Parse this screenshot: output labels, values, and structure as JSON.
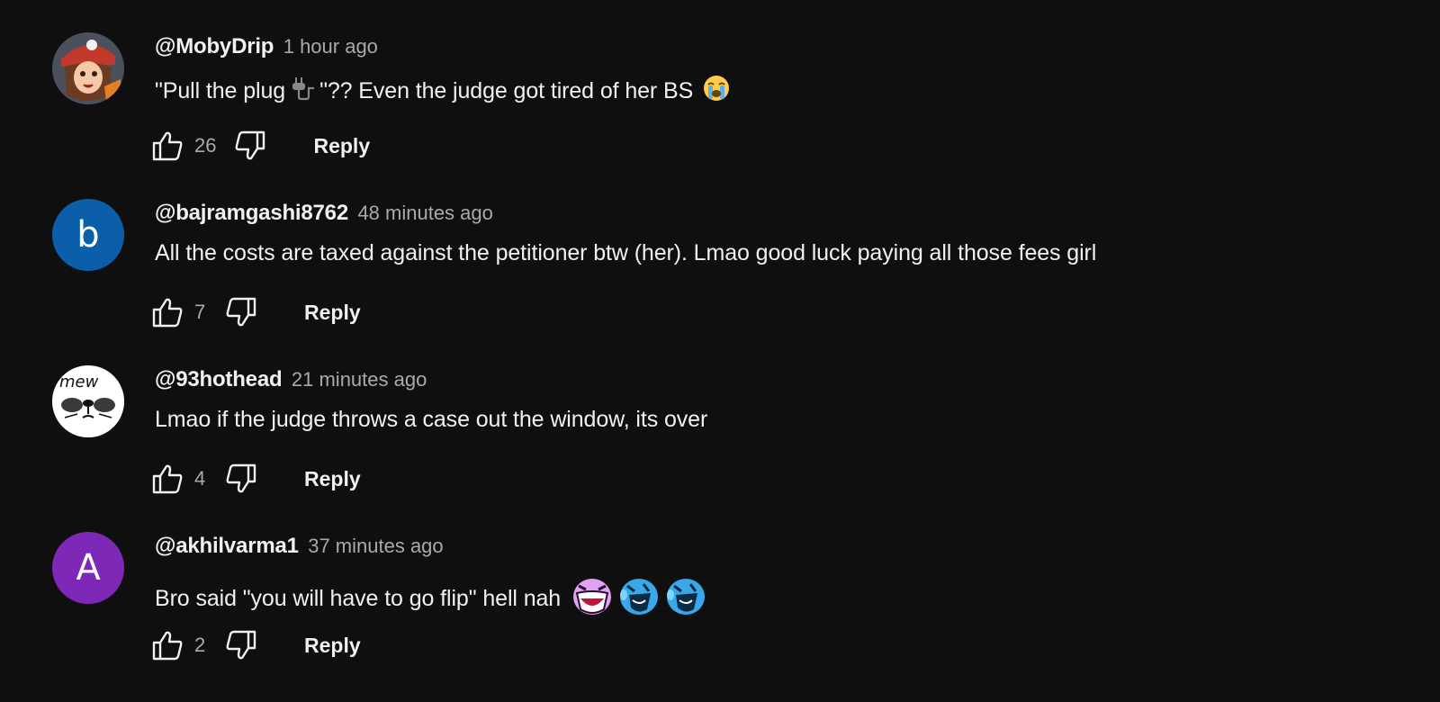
{
  "comments": [
    {
      "author": "@MobyDrip",
      "time": "1 hour ago",
      "text_before": "\"Pull the plug ",
      "text_after": "\"?? Even the judge got tired of her BS",
      "inline_icon_1": "plug-icon",
      "inline_icon_2": "crying-face-emoji",
      "likes": "26",
      "reply_label": "Reply",
      "avatar_type": "image",
      "avatar_icon": "anime-character-avatar"
    },
    {
      "author": "@bajramgashi8762",
      "time": "48 minutes ago",
      "text": "All the costs are taxed against the petitioner btw (her). Lmao good luck paying all those fees girl",
      "likes": "7",
      "reply_label": "Reply",
      "avatar_letter": "b",
      "avatar_color": "#0b5ea8"
    },
    {
      "author": "@93hothead",
      "time": "21 minutes ago",
      "text": "Lmao if the judge throws a case out the window, its over",
      "likes": "4",
      "reply_label": "Reply",
      "avatar_text": "mew",
      "avatar_icon": "cat-face-avatar"
    },
    {
      "author": "@akhilvarma1",
      "time": "37 minutes ago",
      "text": "Bro said \"you will have to go flip\" hell nah",
      "inline_icons": [
        "laughing-face-emoji",
        "blue-laughing-emoji",
        "blue-laughing-emoji"
      ],
      "likes": "2",
      "reply_label": "Reply",
      "avatar_letter": "A",
      "avatar_color": "#7e28b8"
    }
  ],
  "colors": {
    "background": "#0f0f0f",
    "text_primary": "#f1f1f1",
    "text_secondary": "#aaaaaa"
  },
  "icons": {
    "like": "thumbs-up-icon",
    "dislike": "thumbs-down-icon"
  }
}
